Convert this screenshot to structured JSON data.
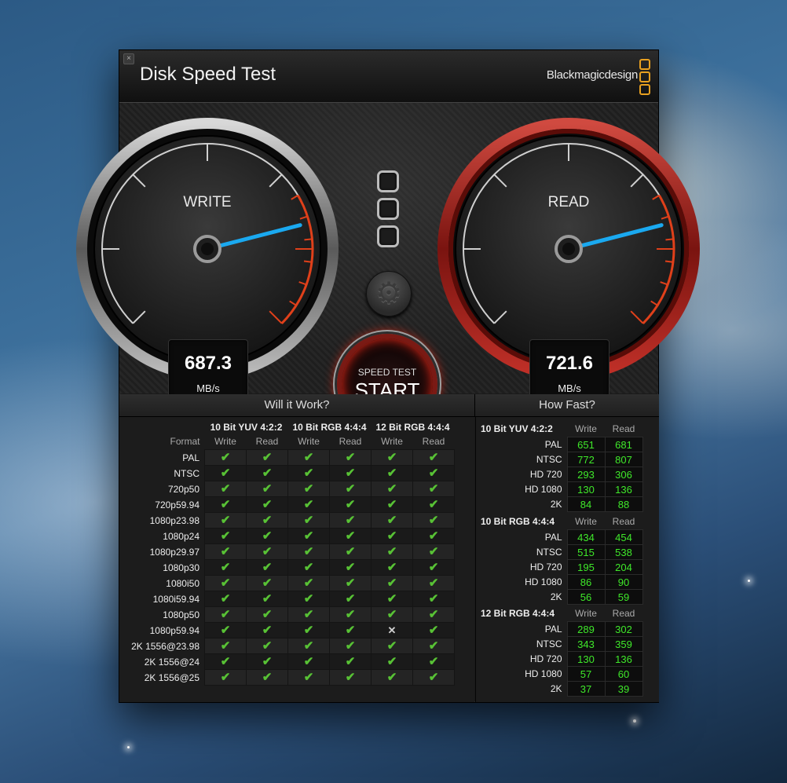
{
  "app": {
    "title": "Disk Speed Test",
    "brand": "Blackmagicdesign",
    "close_glyph": "×"
  },
  "gauges": {
    "write": {
      "label": "WRITE",
      "value": "687.3",
      "unit": "MB/s",
      "needle_fraction": 0.78
    },
    "read": {
      "label": "READ",
      "value": "721.6",
      "unit": "MB/s",
      "needle_fraction": 0.78
    }
  },
  "start_button": {
    "small_label": "SPEED TEST",
    "label": "START"
  },
  "settings_icon": "gear-icon",
  "will_it_work": {
    "title": "Will it Work?",
    "format_header": "Format",
    "groups": [
      "10 Bit YUV 4:2:2",
      "10 Bit RGB 4:4:4",
      "12 Bit RGB 4:4:4"
    ],
    "sub_headers": [
      "Write",
      "Read"
    ],
    "rows": [
      {
        "format": "PAL",
        "marks": [
          "ok",
          "ok",
          "ok",
          "ok",
          "ok",
          "ok"
        ]
      },
      {
        "format": "NTSC",
        "marks": [
          "ok",
          "ok",
          "ok",
          "ok",
          "ok",
          "ok"
        ]
      },
      {
        "format": "720p50",
        "marks": [
          "ok",
          "ok",
          "ok",
          "ok",
          "ok",
          "ok"
        ]
      },
      {
        "format": "720p59.94",
        "marks": [
          "ok",
          "ok",
          "ok",
          "ok",
          "ok",
          "ok"
        ]
      },
      {
        "format": "1080p23.98",
        "marks": [
          "ok",
          "ok",
          "ok",
          "ok",
          "ok",
          "ok"
        ]
      },
      {
        "format": "1080p24",
        "marks": [
          "ok",
          "ok",
          "ok",
          "ok",
          "ok",
          "ok"
        ]
      },
      {
        "format": "1080p29.97",
        "marks": [
          "ok",
          "ok",
          "ok",
          "ok",
          "ok",
          "ok"
        ]
      },
      {
        "format": "1080p30",
        "marks": [
          "ok",
          "ok",
          "ok",
          "ok",
          "ok",
          "ok"
        ]
      },
      {
        "format": "1080i50",
        "marks": [
          "ok",
          "ok",
          "ok",
          "ok",
          "ok",
          "ok"
        ]
      },
      {
        "format": "1080i59.94",
        "marks": [
          "ok",
          "ok",
          "ok",
          "ok",
          "ok",
          "ok"
        ]
      },
      {
        "format": "1080p50",
        "marks": [
          "ok",
          "ok",
          "ok",
          "ok",
          "ok",
          "ok"
        ]
      },
      {
        "format": "1080p59.94",
        "marks": [
          "ok",
          "ok",
          "ok",
          "ok",
          "no",
          "ok"
        ]
      },
      {
        "format": "2K 1556@23.98",
        "marks": [
          "ok",
          "ok",
          "ok",
          "ok",
          "ok",
          "ok"
        ]
      },
      {
        "format": "2K 1556@24",
        "marks": [
          "ok",
          "ok",
          "ok",
          "ok",
          "ok",
          "ok"
        ]
      },
      {
        "format": "2K 1556@25",
        "marks": [
          "ok",
          "ok",
          "ok",
          "ok",
          "ok",
          "ok"
        ]
      }
    ]
  },
  "how_fast": {
    "title": "How Fast?",
    "col_write": "Write",
    "col_read": "Read",
    "groups": [
      {
        "name": "10 Bit YUV 4:2:2",
        "rows": [
          {
            "label": "PAL",
            "write": "651",
            "read": "681"
          },
          {
            "label": "NTSC",
            "write": "772",
            "read": "807"
          },
          {
            "label": "HD 720",
            "write": "293",
            "read": "306"
          },
          {
            "label": "HD 1080",
            "write": "130",
            "read": "136"
          },
          {
            "label": "2K",
            "write": "84",
            "read": "88"
          }
        ]
      },
      {
        "name": "10 Bit RGB 4:4:4",
        "rows": [
          {
            "label": "PAL",
            "write": "434",
            "read": "454"
          },
          {
            "label": "NTSC",
            "write": "515",
            "read": "538"
          },
          {
            "label": "HD 720",
            "write": "195",
            "read": "204"
          },
          {
            "label": "HD 1080",
            "write": "86",
            "read": "90"
          },
          {
            "label": "2K",
            "write": "56",
            "read": "59"
          }
        ]
      },
      {
        "name": "12 Bit RGB 4:4:4",
        "rows": [
          {
            "label": "PAL",
            "write": "289",
            "read": "302"
          },
          {
            "label": "NTSC",
            "write": "343",
            "read": "359"
          },
          {
            "label": "HD 720",
            "write": "130",
            "read": "136"
          },
          {
            "label": "HD 1080",
            "write": "57",
            "read": "60"
          },
          {
            "label": "2K",
            "write": "37",
            "read": "39"
          }
        ]
      }
    ]
  },
  "colors": {
    "ok_check": "#58c235",
    "number_green": "#3fe82a",
    "needle_blue": "#1aa9f0",
    "read_ring": "#b0201a",
    "brand_orange": "#e8a020"
  }
}
